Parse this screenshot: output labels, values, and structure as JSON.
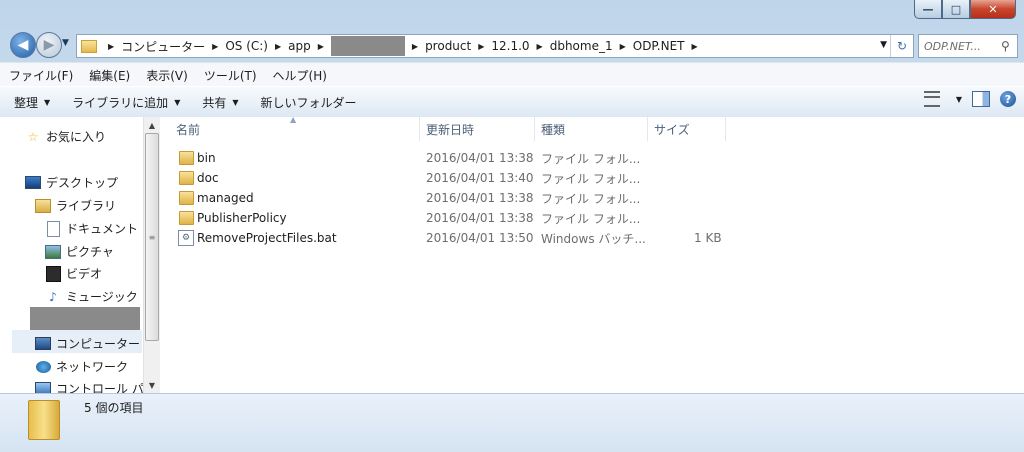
{
  "window": {
    "min_glyph": "—",
    "max_glyph": "□",
    "close_glyph": "✕"
  },
  "nav": {
    "back_glyph": "◀",
    "forward_glyph": "▶",
    "dropdown_glyph": "▼"
  },
  "address": {
    "crumbs": [
      "コンピューター",
      "OS (C:)",
      "app",
      "product",
      "12.1.0",
      "dbhome_1",
      "ODP.NET"
    ],
    "separator": "▶",
    "dropdown_glyph": "▼",
    "refresh_glyph": "↻"
  },
  "search": {
    "placeholder": "ODP.NET...",
    "icon": "search-icon",
    "glyph": "⚲"
  },
  "menubar": {
    "items": [
      "ファイル(F)",
      "編集(E)",
      "表示(V)",
      "ツール(T)",
      "ヘルプ(H)"
    ]
  },
  "toolbar": {
    "organize": "整理",
    "add_to_library": "ライブラリに追加",
    "share": "共有",
    "new_folder": "新しいフォルダー",
    "caret": "▼",
    "help": "?"
  },
  "navpane": {
    "favorites": "お気に入り",
    "desktop": "デスクトップ",
    "libraries": "ライブラリ",
    "documents": "ドキュメント",
    "pictures": "ピクチャ",
    "videos": "ビデオ",
    "music": "ミュージック",
    "computer": "コンピューター",
    "network": "ネットワーク",
    "control_panel": "コントロール パ",
    "star_glyph": "☆",
    "music_glyph": "♪"
  },
  "scroll": {
    "up": "▲",
    "down": "▼",
    "grip": "≡"
  },
  "columns": {
    "name": "名前",
    "modified": "更新日時",
    "type": "種類",
    "size": "サイズ",
    "sort_glyph": "▲"
  },
  "files": [
    {
      "name": "bin",
      "modified": "2016/04/01 13:38",
      "type": "ファイル フォル...",
      "size": "",
      "kind": "folder"
    },
    {
      "name": "doc",
      "modified": "2016/04/01 13:40",
      "type": "ファイル フォル...",
      "size": "",
      "kind": "folder"
    },
    {
      "name": "managed",
      "modified": "2016/04/01 13:38",
      "type": "ファイル フォル...",
      "size": "",
      "kind": "folder"
    },
    {
      "name": "PublisherPolicy",
      "modified": "2016/04/01 13:38",
      "type": "ファイル フォル...",
      "size": "",
      "kind": "folder"
    },
    {
      "name": "RemoveProjectFiles.bat",
      "modified": "2016/04/01 13:50",
      "type": "Windows バッチ...",
      "size": "1 KB",
      "kind": "bat"
    }
  ],
  "file_icon_glyph": "⚙",
  "status": {
    "count_text": "5 個の項目"
  }
}
